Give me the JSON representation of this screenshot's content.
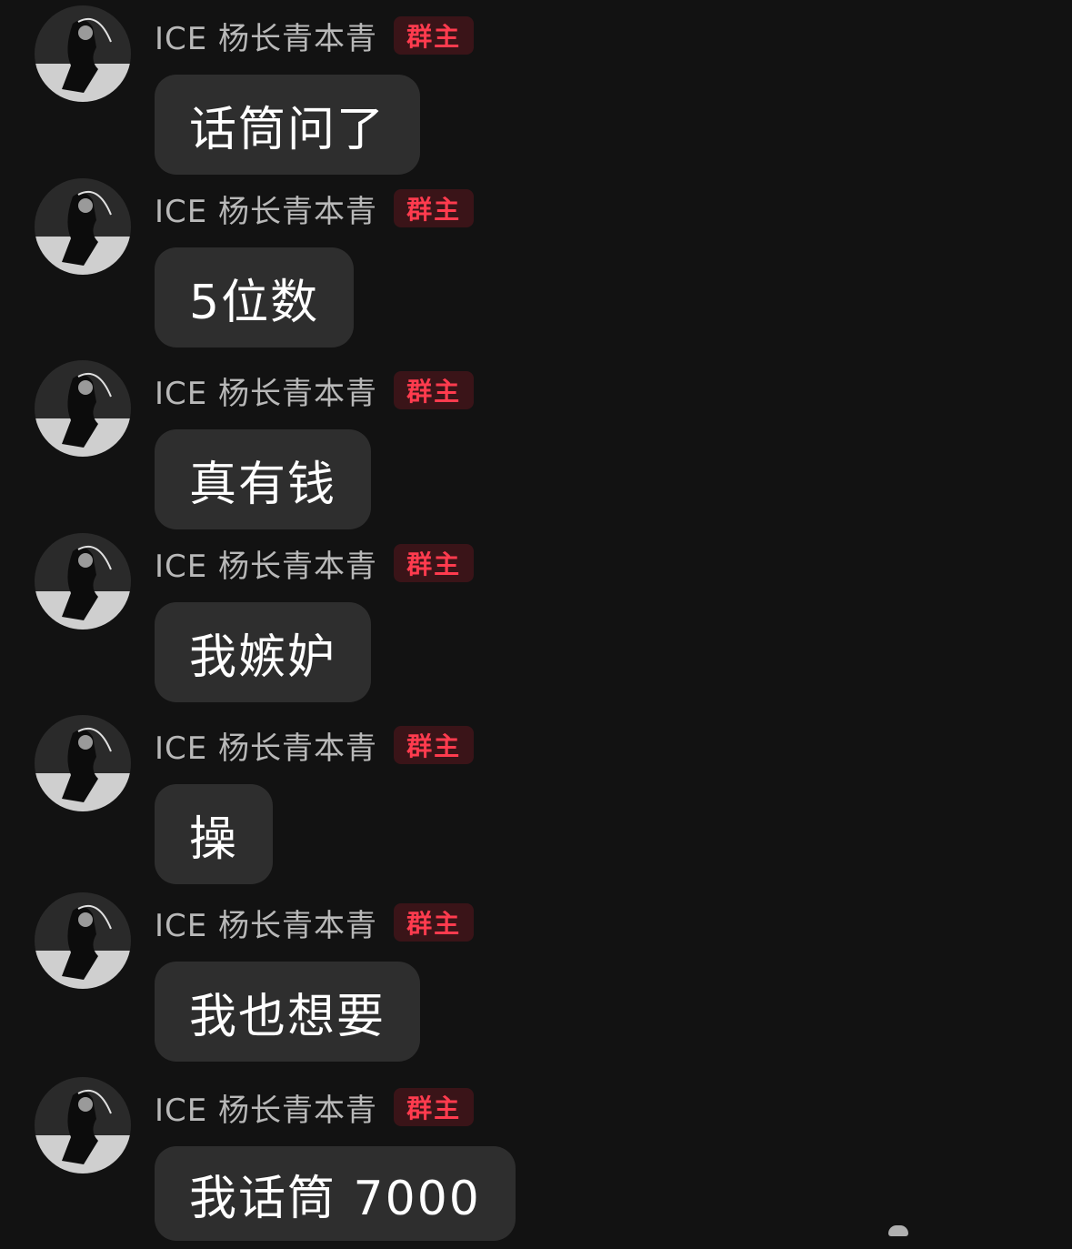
{
  "messages": [
    {
      "sender": "ICE 杨长青本青",
      "badge": "群主",
      "text": "话筒问了"
    },
    {
      "sender": "ICE 杨长青本青",
      "badge": "群主",
      "text": "5位数"
    },
    {
      "sender": "ICE 杨长青本青",
      "badge": "群主",
      "text": "真有钱"
    },
    {
      "sender": "ICE 杨长青本青",
      "badge": "群主",
      "text": "我嫉妒"
    },
    {
      "sender": "ICE 杨长青本青",
      "badge": "群主",
      "text": "操"
    },
    {
      "sender": "ICE 杨长青本青",
      "badge": "群主",
      "text": "我也想要"
    },
    {
      "sender": "ICE 杨长青本青",
      "badge": "群主",
      "text": "我话筒 7000"
    }
  ],
  "colors": {
    "background": "#121212",
    "bubble": "#2e2e2e",
    "badge_bg": "#3a1418",
    "badge_text": "#ff3b4e",
    "nick_text": "#b8b8b8"
  },
  "icons": {
    "avatar": "avatar-icon"
  }
}
